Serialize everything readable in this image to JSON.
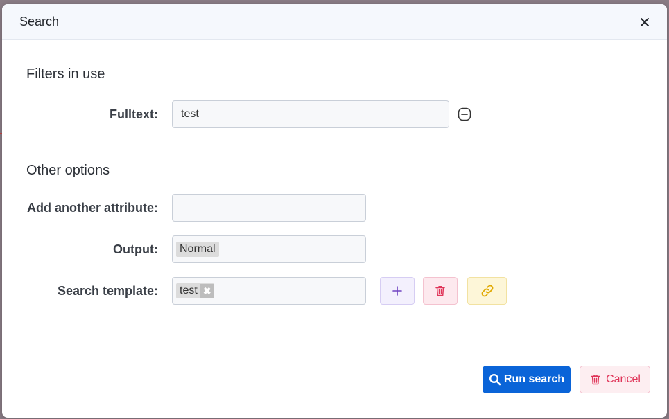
{
  "dialog": {
    "title": "Search"
  },
  "sections": {
    "filters_title": "Filters in use",
    "other_title": "Other options"
  },
  "filters": {
    "fulltext_label": "Fulltext:",
    "fulltext_value": "test"
  },
  "options": {
    "attribute_label": "Add another attribute:",
    "attribute_value": "",
    "output_label": "Output:",
    "output_value": "Normal",
    "template_label": "Search template:",
    "template_value": "test",
    "template_remove": "✖"
  },
  "footer": {
    "run_label": "Run search",
    "cancel_label": "Cancel"
  },
  "icons": {
    "close": "close-icon",
    "remove_filter": "minus-circle-icon",
    "add": "plus-icon",
    "delete": "trash-icon",
    "link": "link-icon",
    "search": "search-icon"
  },
  "colors": {
    "primary": "#0a64d8",
    "danger": "#e0365a",
    "purple": "#6f42c1",
    "warning": "#e0a800"
  }
}
